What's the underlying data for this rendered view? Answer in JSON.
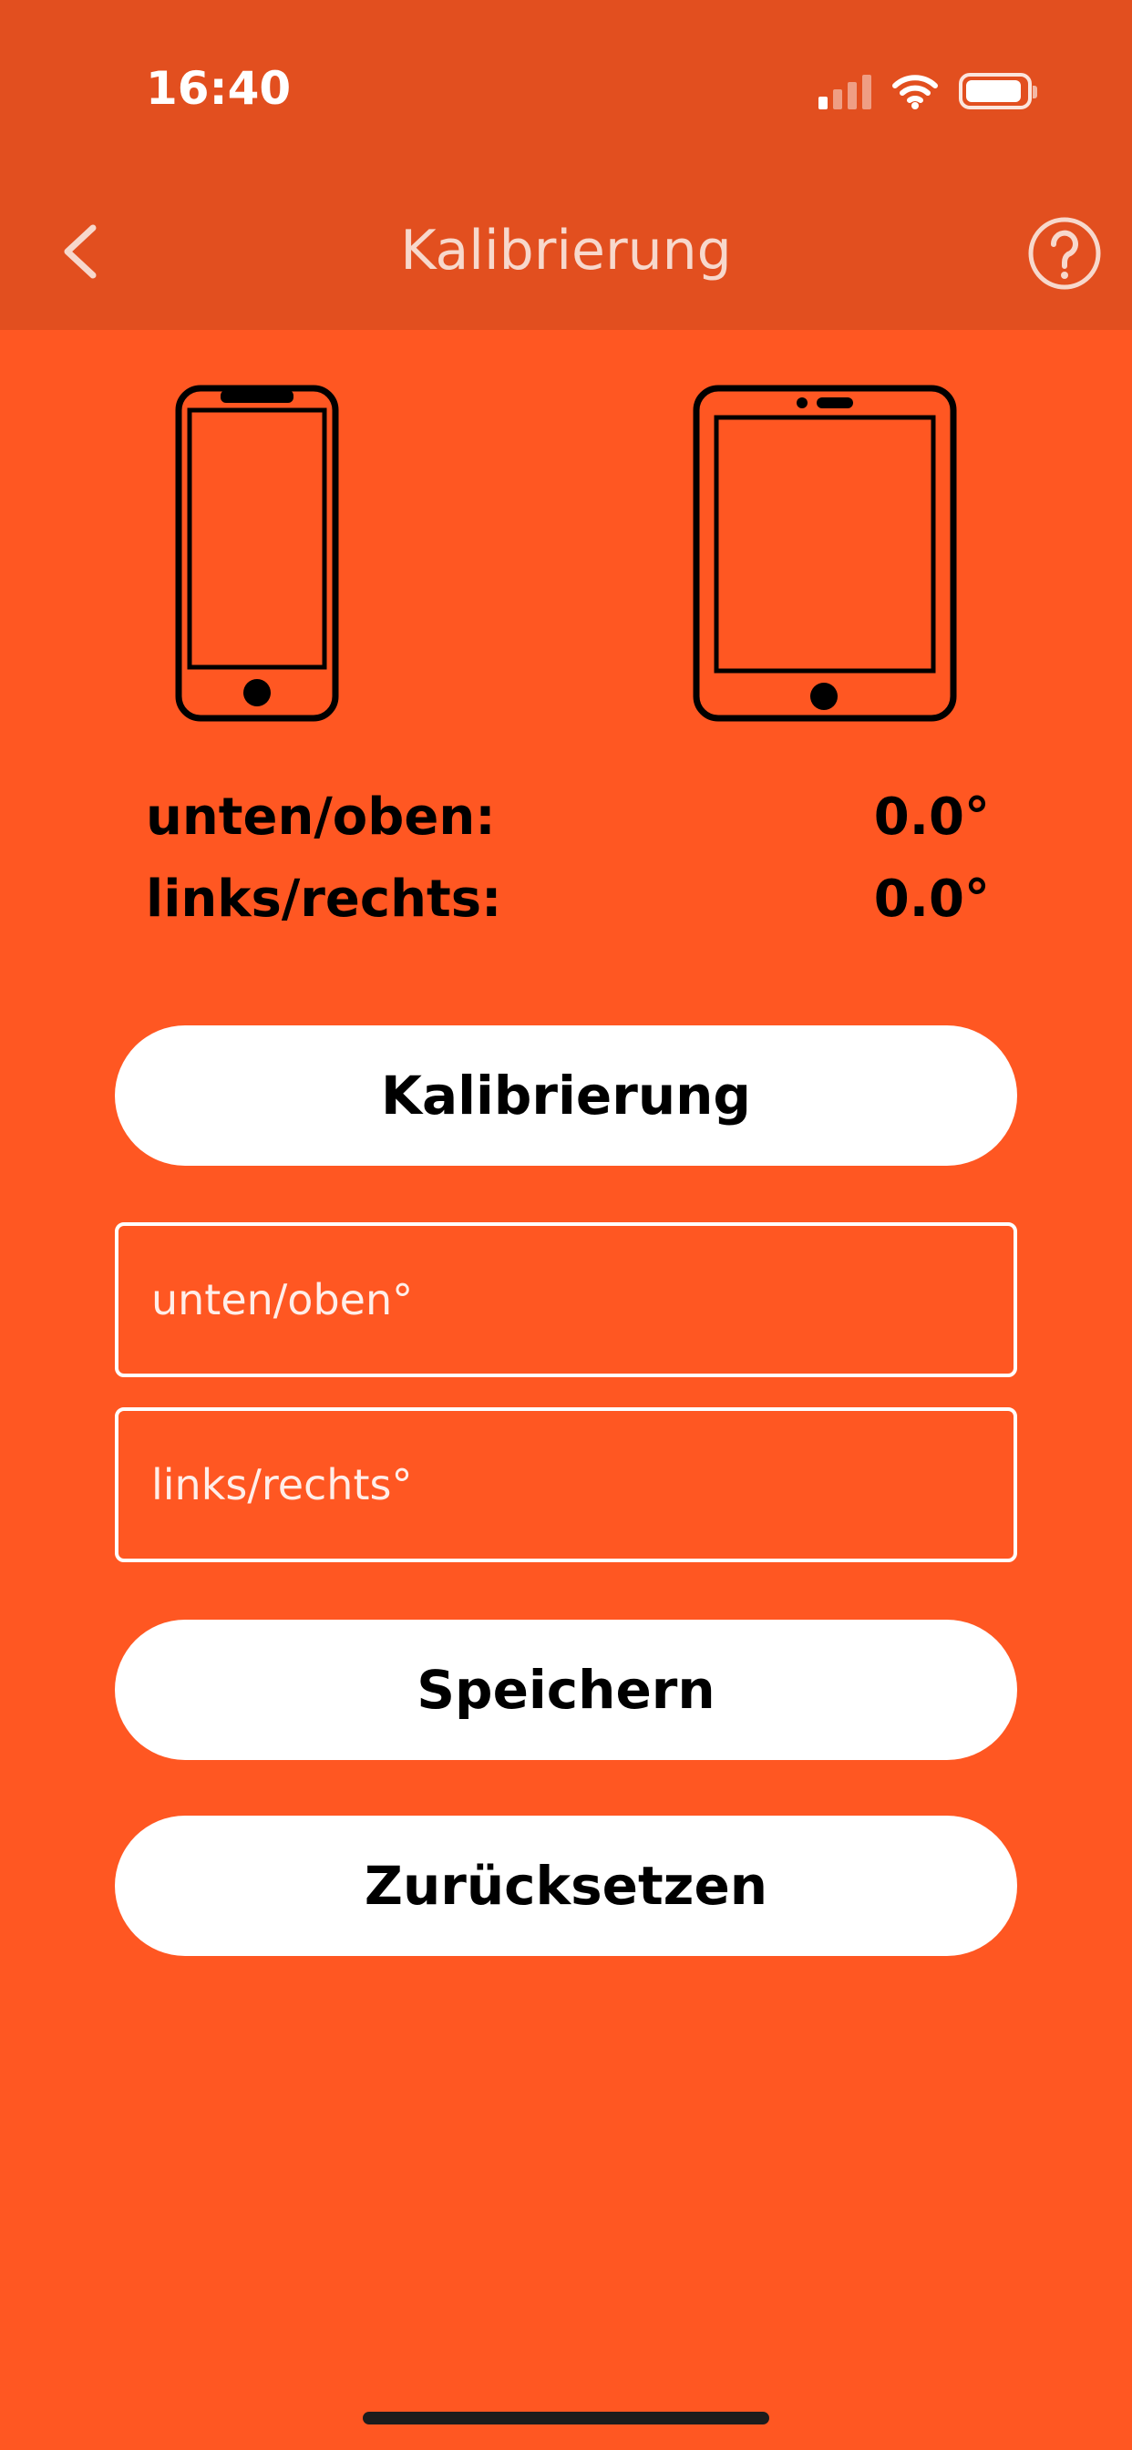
{
  "status_bar": {
    "time": "16:40"
  },
  "nav": {
    "title": "Kalibrierung",
    "back_icon": "chevron-left-icon",
    "help_icon": "question-circle-icon"
  },
  "devices": {
    "left": "phone-icon",
    "right": "tablet-icon"
  },
  "readings": [
    {
      "label": "unten/oben:",
      "value": "0.0°"
    },
    {
      "label": "links/rechts:",
      "value": "0.0°"
    }
  ],
  "buttons": {
    "calibrate": "Kalibrierung",
    "save": "Speichern",
    "reset": "Zurücksetzen"
  },
  "inputs": {
    "vertical": {
      "placeholder": "unten/oben°",
      "value": ""
    },
    "horizontal": {
      "placeholder": "links/rechts°",
      "value": ""
    }
  },
  "colors": {
    "background": "#FF5722",
    "header": "#E24F1F",
    "button": "#FFFFFF",
    "text": "#000000"
  }
}
